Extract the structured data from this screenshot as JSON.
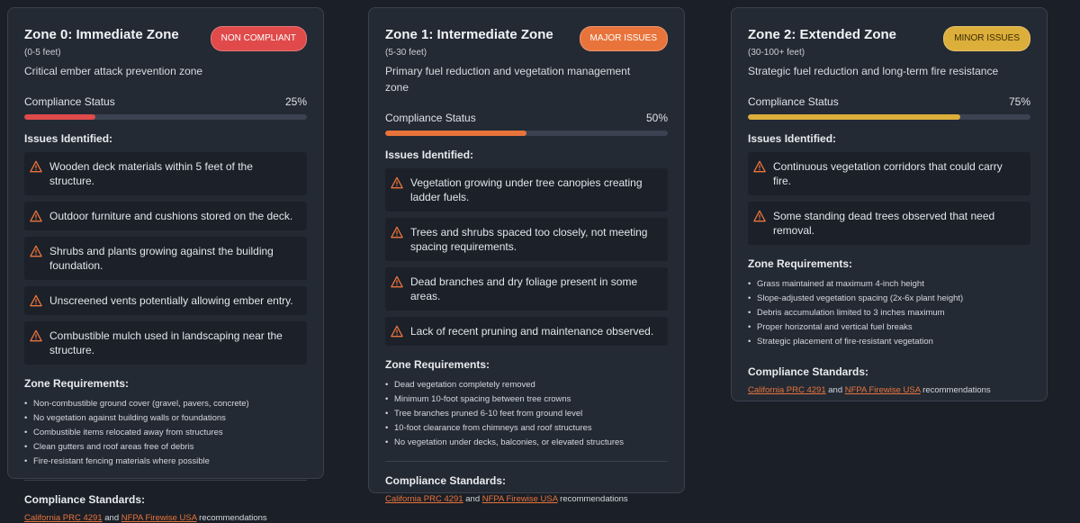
{
  "labels": {
    "compliance_status": "Compliance Status",
    "issues_identified": "Issues Identified:",
    "zone_requirements": "Zone Requirements:",
    "compliance_standards": "Compliance Standards:",
    "std_link1": "California PRC 4291",
    "std_and": " and ",
    "std_link2": "NFPA Firewise USA",
    "std_tail": " recommendations"
  },
  "colors": {
    "red": "#e04a4a",
    "orange": "#e8743b",
    "yellow": "#dcae3a",
    "warn_icon": "#e8743b"
  },
  "zones": [
    {
      "title": "Zone 0: Immediate Zone",
      "feet": "(0-5 feet)",
      "desc": "Critical ember attack prevention zone",
      "badge": "NON COMPLIANT",
      "percent_label": "25%",
      "percent": 0.25,
      "issues": [
        "Wooden deck materials within 5 feet of the structure.",
        "Outdoor furniture and cushions stored on the deck.",
        "Shrubs and plants growing against the building foundation.",
        "Unscreened vents potentially allowing ember entry.",
        "Combustible mulch used in landscaping near the structure."
      ],
      "requirements": [
        "Non-combustible ground cover (gravel, pavers, concrete)",
        "No vegetation against building walls or foundations",
        "Combustible items relocated away from structures",
        "Clean gutters and roof areas free of debris",
        "Fire-resistant fencing materials where possible"
      ]
    },
    {
      "title": "Zone 1: Intermediate Zone",
      "feet": "(5-30 feet)",
      "desc": "Primary fuel reduction and vegetation management zone",
      "badge": "MAJOR ISSUES",
      "percent_label": "50%",
      "percent": 0.5,
      "issues": [
        "Vegetation growing under tree canopies creating ladder fuels.",
        "Trees and shrubs spaced too closely, not meeting spacing requirements.",
        "Dead branches and dry foliage present in some areas.",
        "Lack of recent pruning and maintenance observed."
      ],
      "requirements": [
        "Dead vegetation completely removed",
        "Minimum 10-foot spacing between tree crowns",
        "Tree branches pruned 6-10 feet from ground level",
        "10-foot clearance from chimneys and roof structures",
        "No vegetation under decks, balconies, or elevated structures"
      ]
    },
    {
      "title": "Zone 2: Extended Zone",
      "feet": "(30-100+ feet)",
      "desc": "Strategic fuel reduction and long-term fire resistance",
      "badge": "MINOR ISSUES",
      "percent_label": "75%",
      "percent": 0.75,
      "issues": [
        "Continuous vegetation corridors that could carry fire.",
        "Some standing dead trees observed that need removal."
      ],
      "requirements": [
        "Grass maintained at maximum 4-inch height",
        "Slope-adjusted vegetation spacing (2x-6x plant height)",
        "Debris accumulation limited to 3 inches maximum",
        "Proper horizontal and vertical fuel breaks",
        "Strategic placement of fire-resistant vegetation"
      ]
    }
  ]
}
